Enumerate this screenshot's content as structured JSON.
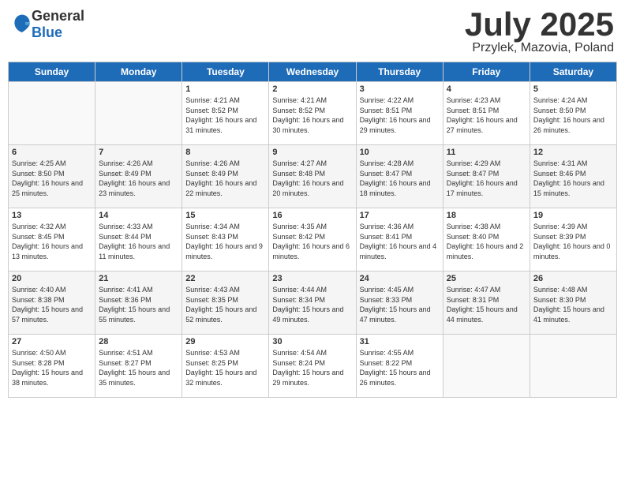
{
  "logo": {
    "general": "General",
    "blue": "Blue"
  },
  "title": "July 2025",
  "subtitle": "Przylek, Mazovia, Poland",
  "weekdays": [
    "Sunday",
    "Monday",
    "Tuesday",
    "Wednesday",
    "Thursday",
    "Friday",
    "Saturday"
  ],
  "weeks": [
    [
      {
        "day": "",
        "sunrise": "",
        "sunset": "",
        "daylight": ""
      },
      {
        "day": "",
        "sunrise": "",
        "sunset": "",
        "daylight": ""
      },
      {
        "day": "1",
        "sunrise": "Sunrise: 4:21 AM",
        "sunset": "Sunset: 8:52 PM",
        "daylight": "Daylight: 16 hours and 31 minutes."
      },
      {
        "day": "2",
        "sunrise": "Sunrise: 4:21 AM",
        "sunset": "Sunset: 8:52 PM",
        "daylight": "Daylight: 16 hours and 30 minutes."
      },
      {
        "day": "3",
        "sunrise": "Sunrise: 4:22 AM",
        "sunset": "Sunset: 8:51 PM",
        "daylight": "Daylight: 16 hours and 29 minutes."
      },
      {
        "day": "4",
        "sunrise": "Sunrise: 4:23 AM",
        "sunset": "Sunset: 8:51 PM",
        "daylight": "Daylight: 16 hours and 27 minutes."
      },
      {
        "day": "5",
        "sunrise": "Sunrise: 4:24 AM",
        "sunset": "Sunset: 8:50 PM",
        "daylight": "Daylight: 16 hours and 26 minutes."
      }
    ],
    [
      {
        "day": "6",
        "sunrise": "Sunrise: 4:25 AM",
        "sunset": "Sunset: 8:50 PM",
        "daylight": "Daylight: 16 hours and 25 minutes."
      },
      {
        "day": "7",
        "sunrise": "Sunrise: 4:26 AM",
        "sunset": "Sunset: 8:49 PM",
        "daylight": "Daylight: 16 hours and 23 minutes."
      },
      {
        "day": "8",
        "sunrise": "Sunrise: 4:26 AM",
        "sunset": "Sunset: 8:49 PM",
        "daylight": "Daylight: 16 hours and 22 minutes."
      },
      {
        "day": "9",
        "sunrise": "Sunrise: 4:27 AM",
        "sunset": "Sunset: 8:48 PM",
        "daylight": "Daylight: 16 hours and 20 minutes."
      },
      {
        "day": "10",
        "sunrise": "Sunrise: 4:28 AM",
        "sunset": "Sunset: 8:47 PM",
        "daylight": "Daylight: 16 hours and 18 minutes."
      },
      {
        "day": "11",
        "sunrise": "Sunrise: 4:29 AM",
        "sunset": "Sunset: 8:47 PM",
        "daylight": "Daylight: 16 hours and 17 minutes."
      },
      {
        "day": "12",
        "sunrise": "Sunrise: 4:31 AM",
        "sunset": "Sunset: 8:46 PM",
        "daylight": "Daylight: 16 hours and 15 minutes."
      }
    ],
    [
      {
        "day": "13",
        "sunrise": "Sunrise: 4:32 AM",
        "sunset": "Sunset: 8:45 PM",
        "daylight": "Daylight: 16 hours and 13 minutes."
      },
      {
        "day": "14",
        "sunrise": "Sunrise: 4:33 AM",
        "sunset": "Sunset: 8:44 PM",
        "daylight": "Daylight: 16 hours and 11 minutes."
      },
      {
        "day": "15",
        "sunrise": "Sunrise: 4:34 AM",
        "sunset": "Sunset: 8:43 PM",
        "daylight": "Daylight: 16 hours and 9 minutes."
      },
      {
        "day": "16",
        "sunrise": "Sunrise: 4:35 AM",
        "sunset": "Sunset: 8:42 PM",
        "daylight": "Daylight: 16 hours and 6 minutes."
      },
      {
        "day": "17",
        "sunrise": "Sunrise: 4:36 AM",
        "sunset": "Sunset: 8:41 PM",
        "daylight": "Daylight: 16 hours and 4 minutes."
      },
      {
        "day": "18",
        "sunrise": "Sunrise: 4:38 AM",
        "sunset": "Sunset: 8:40 PM",
        "daylight": "Daylight: 16 hours and 2 minutes."
      },
      {
        "day": "19",
        "sunrise": "Sunrise: 4:39 AM",
        "sunset": "Sunset: 8:39 PM",
        "daylight": "Daylight: 16 hours and 0 minutes."
      }
    ],
    [
      {
        "day": "20",
        "sunrise": "Sunrise: 4:40 AM",
        "sunset": "Sunset: 8:38 PM",
        "daylight": "Daylight: 15 hours and 57 minutes."
      },
      {
        "day": "21",
        "sunrise": "Sunrise: 4:41 AM",
        "sunset": "Sunset: 8:36 PM",
        "daylight": "Daylight: 15 hours and 55 minutes."
      },
      {
        "day": "22",
        "sunrise": "Sunrise: 4:43 AM",
        "sunset": "Sunset: 8:35 PM",
        "daylight": "Daylight: 15 hours and 52 minutes."
      },
      {
        "day": "23",
        "sunrise": "Sunrise: 4:44 AM",
        "sunset": "Sunset: 8:34 PM",
        "daylight": "Daylight: 15 hours and 49 minutes."
      },
      {
        "day": "24",
        "sunrise": "Sunrise: 4:45 AM",
        "sunset": "Sunset: 8:33 PM",
        "daylight": "Daylight: 15 hours and 47 minutes."
      },
      {
        "day": "25",
        "sunrise": "Sunrise: 4:47 AM",
        "sunset": "Sunset: 8:31 PM",
        "daylight": "Daylight: 15 hours and 44 minutes."
      },
      {
        "day": "26",
        "sunrise": "Sunrise: 4:48 AM",
        "sunset": "Sunset: 8:30 PM",
        "daylight": "Daylight: 15 hours and 41 minutes."
      }
    ],
    [
      {
        "day": "27",
        "sunrise": "Sunrise: 4:50 AM",
        "sunset": "Sunset: 8:28 PM",
        "daylight": "Daylight: 15 hours and 38 minutes."
      },
      {
        "day": "28",
        "sunrise": "Sunrise: 4:51 AM",
        "sunset": "Sunset: 8:27 PM",
        "daylight": "Daylight: 15 hours and 35 minutes."
      },
      {
        "day": "29",
        "sunrise": "Sunrise: 4:53 AM",
        "sunset": "Sunset: 8:25 PM",
        "daylight": "Daylight: 15 hours and 32 minutes."
      },
      {
        "day": "30",
        "sunrise": "Sunrise: 4:54 AM",
        "sunset": "Sunset: 8:24 PM",
        "daylight": "Daylight: 15 hours and 29 minutes."
      },
      {
        "day": "31",
        "sunrise": "Sunrise: 4:55 AM",
        "sunset": "Sunset: 8:22 PM",
        "daylight": "Daylight: 15 hours and 26 minutes."
      },
      {
        "day": "",
        "sunrise": "",
        "sunset": "",
        "daylight": ""
      },
      {
        "day": "",
        "sunrise": "",
        "sunset": "",
        "daylight": ""
      }
    ]
  ]
}
